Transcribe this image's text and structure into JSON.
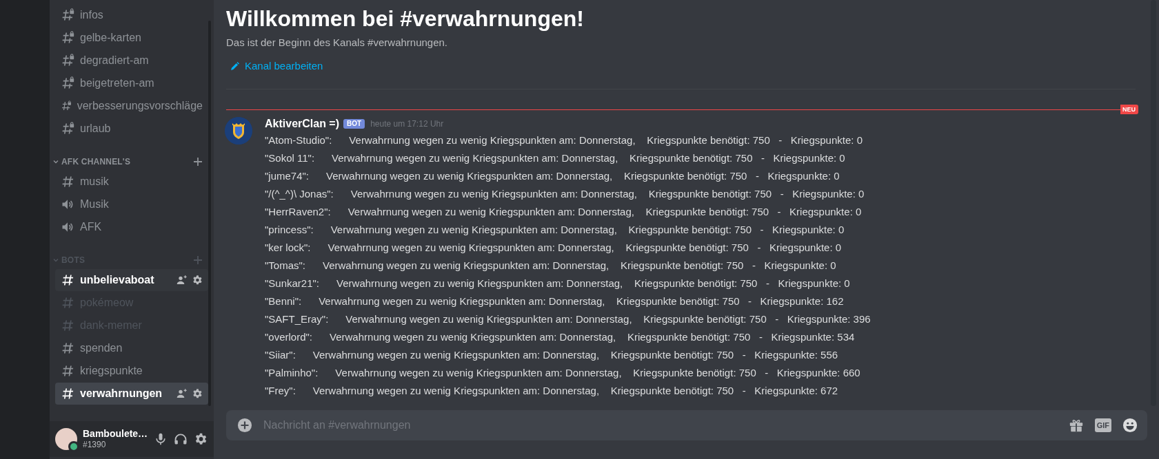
{
  "sidebar": {
    "groups": [
      {
        "channels": [
          {
            "name": "infos",
            "kind": "locked",
            "selected": false,
            "hovered": false,
            "muted": false
          },
          {
            "name": "gelbe-karten",
            "kind": "locked",
            "selected": false,
            "hovered": false,
            "muted": false
          },
          {
            "name": "degradiert-am",
            "kind": "locked",
            "selected": false,
            "hovered": false,
            "muted": false
          },
          {
            "name": "beigetreten-am",
            "kind": "locked",
            "selected": false,
            "hovered": false,
            "muted": false
          },
          {
            "name": "verbesserungsvorschläge",
            "kind": "locked",
            "selected": false,
            "hovered": false,
            "muted": false
          },
          {
            "name": "urlaub",
            "kind": "locked",
            "selected": false,
            "hovered": false,
            "muted": false
          }
        ]
      },
      {
        "category": "AFK CHANNEL'S",
        "muted": false,
        "channels": [
          {
            "name": "musik",
            "kind": "text",
            "selected": false,
            "hovered": false,
            "muted": false
          },
          {
            "name": "Musik",
            "kind": "voice",
            "selected": false,
            "hovered": false,
            "muted": false
          },
          {
            "name": "AFK",
            "kind": "voice",
            "selected": false,
            "hovered": false,
            "muted": false
          }
        ]
      },
      {
        "category": "BOTS",
        "muted": true,
        "channels": [
          {
            "name": "unbelievaboat",
            "kind": "text",
            "selected": false,
            "hovered": true,
            "muted": false
          },
          {
            "name": "pokémeow",
            "kind": "text",
            "selected": false,
            "hovered": false,
            "muted": true
          },
          {
            "name": "dank-memer",
            "kind": "text",
            "selected": false,
            "hovered": false,
            "muted": true
          },
          {
            "name": "spenden",
            "kind": "text",
            "selected": false,
            "hovered": false,
            "muted": false
          },
          {
            "name": "kriegspunkte",
            "kind": "text",
            "selected": false,
            "hovered": false,
            "muted": false
          },
          {
            "name": "verwahrnungen",
            "kind": "text",
            "selected": true,
            "hovered": false,
            "muted": false
          }
        ]
      }
    ],
    "user": {
      "name": "Bamboulete…",
      "tag": "#1390"
    }
  },
  "chat": {
    "welcome": {
      "title": "Willkommen bei #verwahrnungen!",
      "subtitle": "Das ist der Beginn des Kanals #verwahrnungen.",
      "edit_link": "Kanal bearbeiten"
    },
    "new_marker": "NEU",
    "message": {
      "author": "AktiverClan =)",
      "badge": "BOT",
      "time": "heute um 17:12 Uhr",
      "lines": [
        "\"Atom-Studio\":      Verwahrnung wegen zu wenig Kriegspunkten am: Donnerstag,    Kriegspunkte benötigt: 750   -   Kriegspunkte: 0",
        "\"Sokol 11\":      Verwahrnung wegen zu wenig Kriegspunkten am: Donnerstag,    Kriegspunkte benötigt: 750   -   Kriegspunkte: 0",
        "\"jume74\":      Verwahrnung wegen zu wenig Kriegspunkten am: Donnerstag,    Kriegspunkte benötigt: 750   -   Kriegspunkte: 0",
        "\"/(^_^)\\ Jonas\":      Verwahrnung wegen zu wenig Kriegspunkten am: Donnerstag,    Kriegspunkte benötigt: 750   -   Kriegspunkte: 0",
        "\"HerrRaven2\":      Verwahrnung wegen zu wenig Kriegspunkten am: Donnerstag,    Kriegspunkte benötigt: 750   -   Kriegspunkte: 0",
        "\"princess\":      Verwahrnung wegen zu wenig Kriegspunkten am: Donnerstag,    Kriegspunkte benötigt: 750   -   Kriegspunkte: 0",
        "\"ker lock\":      Verwahrnung wegen zu wenig Kriegspunkten am: Donnerstag,    Kriegspunkte benötigt: 750   -   Kriegspunkte: 0",
        "\"Tomas\":      Verwahrnung wegen zu wenig Kriegspunkten am: Donnerstag,    Kriegspunkte benötigt: 750   -   Kriegspunkte: 0",
        "\"Sunkar21\":      Verwahrnung wegen zu wenig Kriegspunkten am: Donnerstag,    Kriegspunkte benötigt: 750   -   Kriegspunkte: 0",
        "\"Benni\":      Verwahrnung wegen zu wenig Kriegspunkten am: Donnerstag,    Kriegspunkte benötigt: 750   -   Kriegspunkte: 162",
        "\"SAFT_Eray\":      Verwahrnung wegen zu wenig Kriegspunkten am: Donnerstag,    Kriegspunkte benötigt: 750   -   Kriegspunkte: 396",
        "\"overlord\":      Verwahrnung wegen zu wenig Kriegspunkten am: Donnerstag,    Kriegspunkte benötigt: 750   -   Kriegspunkte: 534",
        "\"Siiar\":      Verwahrnung wegen zu wenig Kriegspunkten am: Donnerstag,    Kriegspunkte benötigt: 750   -   Kriegspunkte: 556",
        "\"Palminho\":      Verwahrnung wegen zu wenig Kriegspunkten am: Donnerstag,    Kriegspunkte benötigt: 750   -   Kriegspunkte: 660",
        "\"Frey\":      Verwahrnung wegen zu wenig Kriegspunkten am: Donnerstag,    Kriegspunkte benötigt: 750   -   Kriegspunkte: 672"
      ]
    },
    "composer": {
      "placeholder": "Nachricht an #verwahrnungen",
      "gif": "GIF"
    }
  }
}
